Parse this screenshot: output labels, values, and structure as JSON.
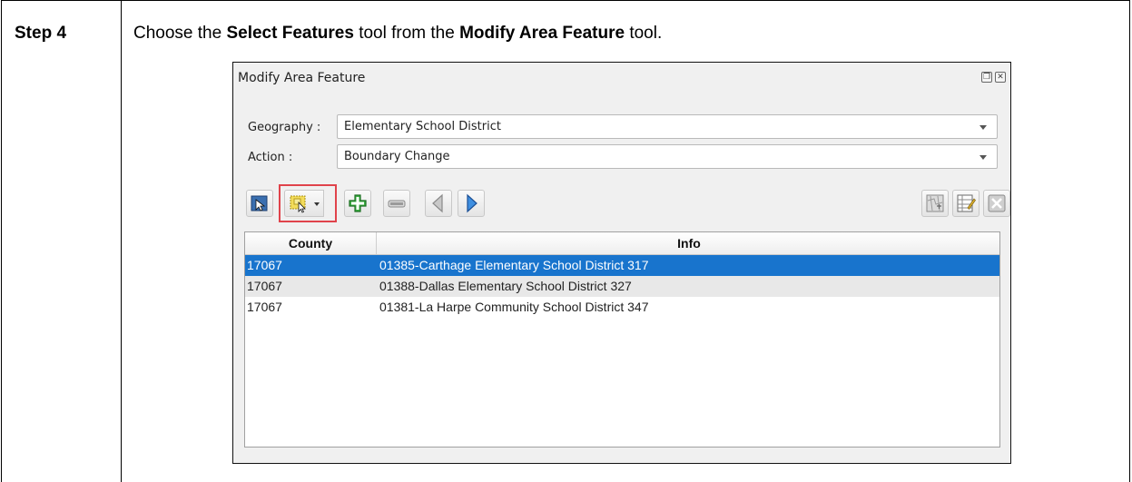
{
  "document": {
    "step_label": "Step 4",
    "instruction_pre": "Choose the ",
    "instruction_bold1": "Select Features",
    "instruction_mid": " tool from the ",
    "instruction_bold2": "Modify Area Feature",
    "instruction_post": " tool."
  },
  "dialog": {
    "title": "Modify Area Feature",
    "float_btn_glyph": "❐",
    "close_btn_glyph": "✕",
    "geography": {
      "label": "Geography :",
      "value": "Elementary School District"
    },
    "action": {
      "label": "Action :",
      "value": "Boundary Change"
    },
    "toolbar": {
      "icons": [
        "pointer-icon",
        "select-features-icon",
        "add-icon",
        "remove-icon",
        "back-icon",
        "forward-icon",
        "map-icon",
        "edit-table-icon",
        "close-x-icon"
      ],
      "highlight_color": "#e0434b"
    },
    "table": {
      "columns": [
        "County",
        "Info"
      ],
      "rows": [
        {
          "county": "17067",
          "info": "01385-Carthage Elementary School District 317",
          "selected": true
        },
        {
          "county": "17067",
          "info": "01388-Dallas Elementary School District 327",
          "selected": false
        },
        {
          "county": "17067",
          "info": "01381-La Harpe Community School District 347",
          "selected": false
        }
      ],
      "selection_color": "#1874cd"
    }
  }
}
